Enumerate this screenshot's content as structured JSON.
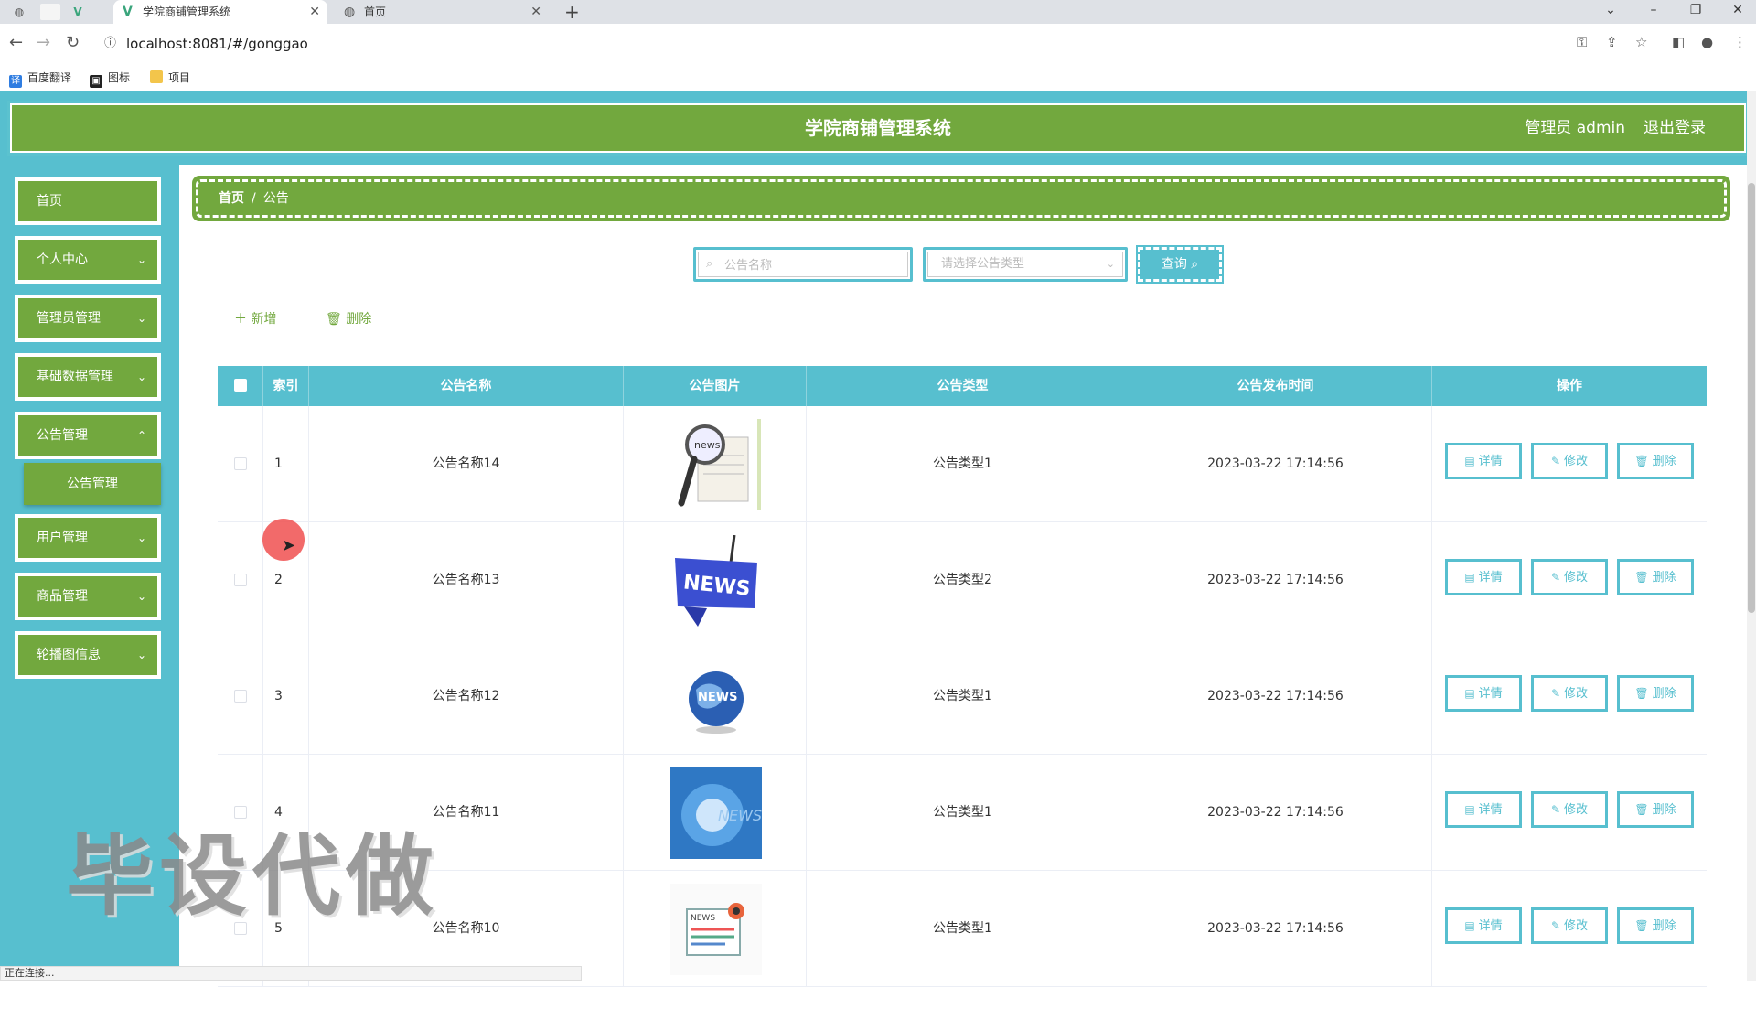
{
  "browser": {
    "tabs": [
      {
        "label": "学院商铺管理系统",
        "active": true
      },
      {
        "label": "首页",
        "active": false
      }
    ],
    "url": "localhost:8081/#/gonggao",
    "bookmarks": [
      "百度翻译",
      "图标",
      "项目"
    ],
    "status_text": "正在连接..."
  },
  "header": {
    "title": "学院商铺管理系统",
    "user": "管理员 admin",
    "logout": "退出登录"
  },
  "sidebar": {
    "items": [
      {
        "label": "首页",
        "expandable": false
      },
      {
        "label": "个人中心",
        "expandable": true
      },
      {
        "label": "管理员管理",
        "expandable": true
      },
      {
        "label": "基础数据管理",
        "expandable": true
      },
      {
        "label": "公告管理",
        "expandable": true
      },
      {
        "label": "用户管理",
        "expandable": true
      },
      {
        "label": "商品管理",
        "expandable": true
      },
      {
        "label": "轮播图信息",
        "expandable": true
      }
    ],
    "submenu_label": "公告管理"
  },
  "breadcrumb": {
    "home": "首页",
    "sep": "/",
    "current": "公告"
  },
  "search": {
    "name_placeholder": "公告名称",
    "type_placeholder": "请选择公告类型",
    "query_label": "查询"
  },
  "actions": {
    "add": "新增",
    "delete": "删除"
  },
  "table": {
    "headers": [
      "索引",
      "公告名称",
      "公告图片",
      "公告类型",
      "公告发布时间",
      "操作"
    ],
    "rows": [
      {
        "index": "1",
        "name": "公告名称14",
        "type": "公告类型1",
        "time": "2023-03-22 17:14:56",
        "image": "news-magnifier"
      },
      {
        "index": "2",
        "name": "公告名称13",
        "type": "公告类型2",
        "time": "2023-03-22 17:14:56",
        "image": "news-sign"
      },
      {
        "index": "3",
        "name": "公告名称12",
        "type": "公告类型1",
        "time": "2023-03-22 17:14:56",
        "image": "news-globe"
      },
      {
        "index": "4",
        "name": "公告名称11",
        "type": "公告类型1",
        "time": "2023-03-22 17:14:56",
        "image": "news-blue"
      },
      {
        "index": "5",
        "name": "公告名称10",
        "type": "公告类型1",
        "time": "2023-03-22 17:14:56",
        "image": "news-paper"
      }
    ],
    "row_actions": {
      "detail": "详情",
      "edit": "修改",
      "delete": "删除"
    }
  },
  "watermark": "毕设代做",
  "colors": {
    "green": "#72a83e",
    "teal": "#57bfcf"
  }
}
